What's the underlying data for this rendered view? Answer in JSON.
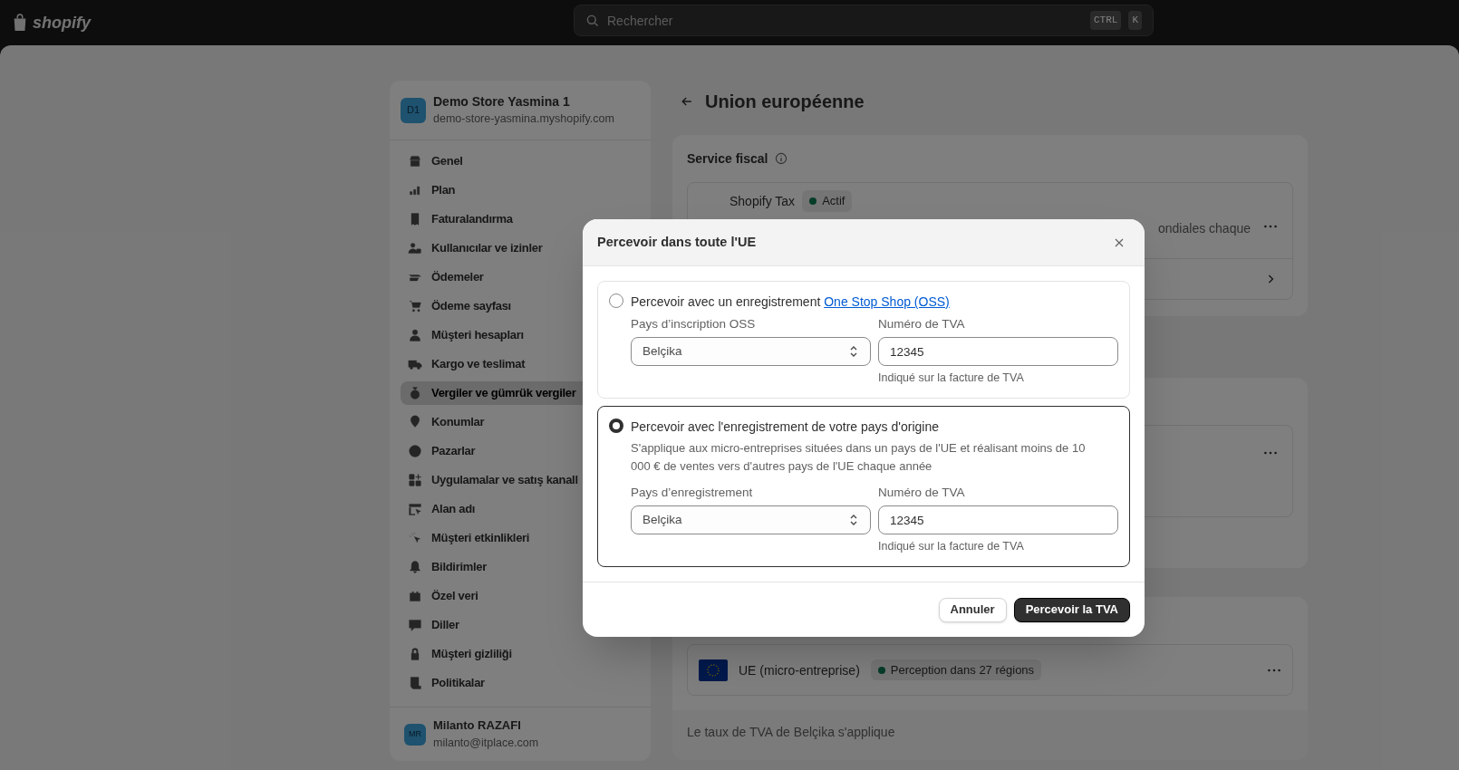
{
  "topbar": {
    "logo": "shopify",
    "search_placeholder": "Rechercher",
    "shortcut_keys": [
      "CTRL",
      "K"
    ]
  },
  "store": {
    "initials": "D1",
    "name": "Demo Store Yasmina 1",
    "domain": "demo-store-yasmina.myshopify.com"
  },
  "nav_items": [
    {
      "label": "Genel",
      "selected": false
    },
    {
      "label": "Plan",
      "selected": false
    },
    {
      "label": "Faturalandırma",
      "selected": false
    },
    {
      "label": "Kullanıcılar ve izinler",
      "selected": false
    },
    {
      "label": "Ödemeler",
      "selected": false
    },
    {
      "label": "Ödeme sayfası",
      "selected": false
    },
    {
      "label": "Müşteri hesapları",
      "selected": false
    },
    {
      "label": "Kargo ve teslimat",
      "selected": false
    },
    {
      "label": "Vergiler ve gümrük vergiler",
      "selected": true
    },
    {
      "label": "Konumlar",
      "selected": false
    },
    {
      "label": "Pazarlar",
      "selected": false
    },
    {
      "label": "Uygulamalar ve satış kanall",
      "selected": false
    },
    {
      "label": "Alan adı",
      "selected": false
    },
    {
      "label": "Müşteri etkinlikleri",
      "selected": false
    },
    {
      "label": "Bildirimler",
      "selected": false
    },
    {
      "label": "Özel veri",
      "selected": false
    },
    {
      "label": "Diller",
      "selected": false
    },
    {
      "label": "Müşteri gizliliği",
      "selected": false
    },
    {
      "label": "Politikalar",
      "selected": false
    }
  ],
  "user": {
    "initials": "MR",
    "name": "Milanto RAZAFI",
    "email": "milanto@itplace.com"
  },
  "page_title": "Union européenne",
  "tax_service": {
    "title": "Service fiscal",
    "provider": "Shopify Tax",
    "status": "Actif",
    "description_fragment": "ondiales chaque"
  },
  "registration": {
    "name": "UE (micro-entreprise)",
    "status": "Perception dans 27 régions",
    "footer": "Le taux de TVA de Belçika s'applique"
  },
  "dialog": {
    "title": "Percevoir dans toute l'UE",
    "options": [
      {
        "selected": false,
        "label": "Percevoir avec un enregistrement ",
        "link": "One Stop Shop (OSS)",
        "fields": [
          {
            "kind": "select",
            "label": "Pays d’inscription OSS",
            "value": "Belçika"
          },
          {
            "kind": "text",
            "label": "Numéro de TVA",
            "value": "12345",
            "help": "Indiqué sur la facture de TVA"
          }
        ]
      },
      {
        "selected": true,
        "label": "Percevoir avec l'enregistrement de votre pays d'origine",
        "description": "S'applique aux micro-entreprises situées dans un pays de l'UE et réalisant moins de 10 000 € de ventes vers d'autres pays de l'UE chaque année",
        "fields": [
          {
            "kind": "select",
            "label": "Pays d’enregistrement",
            "value": "Belçika"
          },
          {
            "kind": "text",
            "label": "Numéro de TVA",
            "value": "12345",
            "help": "Indiqué sur la facture de TVA"
          }
        ]
      }
    ],
    "buttons": [
      {
        "label": "Annuler",
        "kind": "secondary"
      },
      {
        "label": "Percevoir la TVA",
        "kind": "primary"
      }
    ]
  }
}
